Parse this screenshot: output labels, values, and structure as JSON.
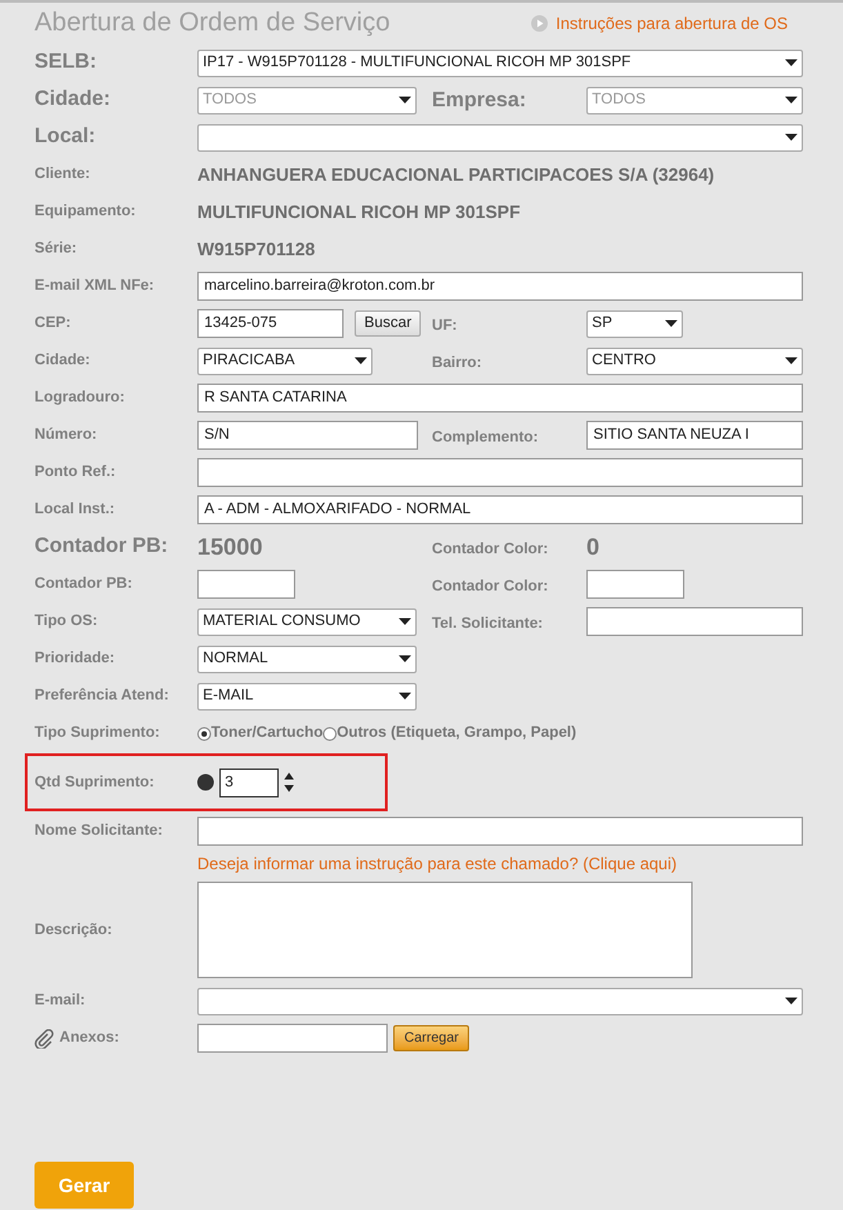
{
  "title": "Abertura de Ordem de Serviço",
  "instructions_link": "Instruções para abertura de OS",
  "rows": [
    {
      "label": "SELB:",
      "field": {
        "kind": "select",
        "value": "IP17 - W915P701128 - MULTIFUNCIONAL RICOH MP 301SPF",
        "disabled": false
      }
    },
    {
      "label": "Cidade:",
      "field": {
        "kind": "select",
        "value": "TODOS",
        "disabled": true
      },
      "right": {
        "label": "Empresa:",
        "field": {
          "kind": "select",
          "value": "TODOS",
          "disabled": true
        }
      }
    },
    {
      "label": "Local:",
      "field": {
        "kind": "select"
      }
    },
    {
      "label": "Cliente:",
      "field": {
        "kind": "text",
        "value": "ANHANGUERA EDUCACIONAL PARTICIPACOES S/A (32964)"
      }
    },
    {
      "label": "Equipamento:",
      "field": {
        "kind": "text",
        "value": "MULTIFUNCIONAL RICOH MP 301SPF"
      }
    },
    {
      "label": "Série:",
      "field": {
        "kind": "text",
        "value": "W915P701128"
      }
    },
    {
      "label": "E-mail XML NFe:",
      "field": {
        "kind": "input",
        "value": "marcelino.barreira@kroton.com.br"
      }
    },
    {
      "label": "CEP:",
      "field": {
        "kind": "input",
        "value": "13425-075",
        "button": "Buscar"
      },
      "right": {
        "label": "UF:",
        "field": {
          "kind": "select",
          "value": "SP",
          "disabled": false
        }
      }
    },
    {
      "label": "Cidade:",
      "field": {
        "kind": "select",
        "value": "PIRACICABA",
        "disabled": false
      },
      "right": {
        "label": "Bairro:",
        "field": {
          "kind": "select",
          "value": "CENTRO",
          "disabled": false
        }
      }
    },
    {
      "label": "Logradouro:",
      "field": {
        "kind": "input",
        "value": "R SANTA CATARINA"
      }
    },
    {
      "label": "Número:",
      "field": {
        "kind": "input",
        "value": "S/N"
      },
      "right": {
        "label": "Complemento:",
        "field": {
          "kind": "input",
          "value": "SITIO SANTA NEUZA I"
        }
      }
    },
    {
      "label": "Ponto Ref.:",
      "field": {
        "kind": "input"
      }
    },
    {
      "label": "Local Inst.:",
      "field": {
        "kind": "input",
        "value": "A - ADM - ALMOXARIFADO - NORMAL"
      }
    },
    {
      "label": "Contador PB:",
      "field": {
        "kind": "value",
        "value": "15000"
      },
      "right": {
        "label": "Contador Color:",
        "field": {
          "kind": "value",
          "value": "0"
        }
      }
    },
    {
      "label": "Contador PB:",
      "field": {
        "kind": "input"
      },
      "right": {
        "label": "Contador Color:",
        "field": {
          "kind": "input"
        }
      }
    },
    {
      "label": "Tipo OS:",
      "field": {
        "kind": "select",
        "value": "MATERIAL CONSUMO",
        "disabled": false
      },
      "right": {
        "label": "Tel. Solicitante:",
        "field": {
          "kind": "input"
        }
      }
    },
    {
      "label": "Prioridade:",
      "field": {
        "kind": "select",
        "value": "NORMAL",
        "disabled": false
      }
    },
    {
      "label": "Preferência Atend:",
      "field": {
        "kind": "select",
        "value": "E-MAIL",
        "disabled": false
      }
    },
    {
      "label": "Tipo Suprimento:",
      "field": {
        "kind": "radios",
        "options": [
          {
            "label": "Toner/Cartucho",
            "selected": true
          },
          {
            "label": "Outros (Etiqueta, Grampo, Papel)",
            "selected": false
          }
        ]
      }
    },
    {
      "label": "Qtd Suprimento:",
      "highlighted": true,
      "field": {
        "kind": "spinner",
        "value": "3"
      }
    },
    {
      "label": "Nome Solicitante:",
      "field": {
        "kind": "input"
      }
    },
    {
      "field": {
        "kind": "link",
        "value": "Deseja informar uma instrução para este chamado? (Clique aqui)"
      }
    },
    {
      "label": "Descrição:",
      "field": {
        "kind": "textarea"
      }
    },
    {
      "label": "E-mail:",
      "field": {
        "kind": "select"
      }
    },
    {
      "label": "Anexos:",
      "attach": true,
      "field": {
        "kind": "input",
        "button": "Carregar"
      }
    }
  ],
  "submit": "Gerar"
}
